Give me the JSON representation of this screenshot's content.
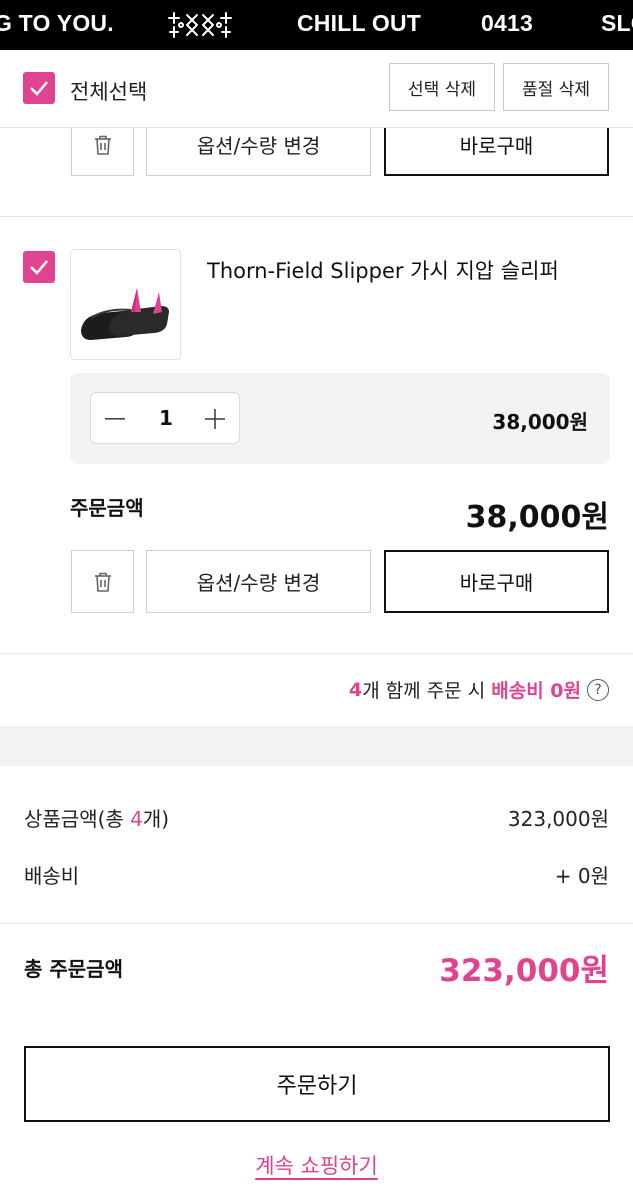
{
  "marquee": {
    "items": [
      "G TO YOU.",
      "CHILL OUT",
      "0413",
      "SLO"
    ]
  },
  "select_bar": {
    "select_all_label": "전체선택",
    "delete_selected": "선택 삭제",
    "delete_soldout": "품절 삭제",
    "checked": true
  },
  "prev_item": {
    "option_button": "옵션/수량 변경",
    "buy_now_button": "바로구매"
  },
  "item": {
    "checked": true,
    "name": "Thorn-Field Slipper 가시 지압 슬리퍼",
    "quantity": "1",
    "line_price": "38,000원",
    "order_amount_label": "주문금액",
    "order_amount": "38,000원",
    "option_button": "옵션/수량 변경",
    "buy_now_button": "바로구매"
  },
  "shipping_note": {
    "count": "4",
    "text1": "개 함께 주문 시 ",
    "highlight": "배송비 0원"
  },
  "summary": {
    "product_amount_label_pre": "상품금액(총 ",
    "product_count": "4",
    "product_amount_label_post": "개)",
    "product_amount": "323,000원",
    "shipping_label": "배송비",
    "shipping_value": "+ 0원",
    "total_label": "총 주문금액",
    "total_value": "323,000원"
  },
  "actions": {
    "order_button": "주문하기",
    "continue_shopping": "계속 쇼핑하기"
  },
  "colors": {
    "accent": "#e0438f",
    "marquee_bg": "#000000"
  }
}
